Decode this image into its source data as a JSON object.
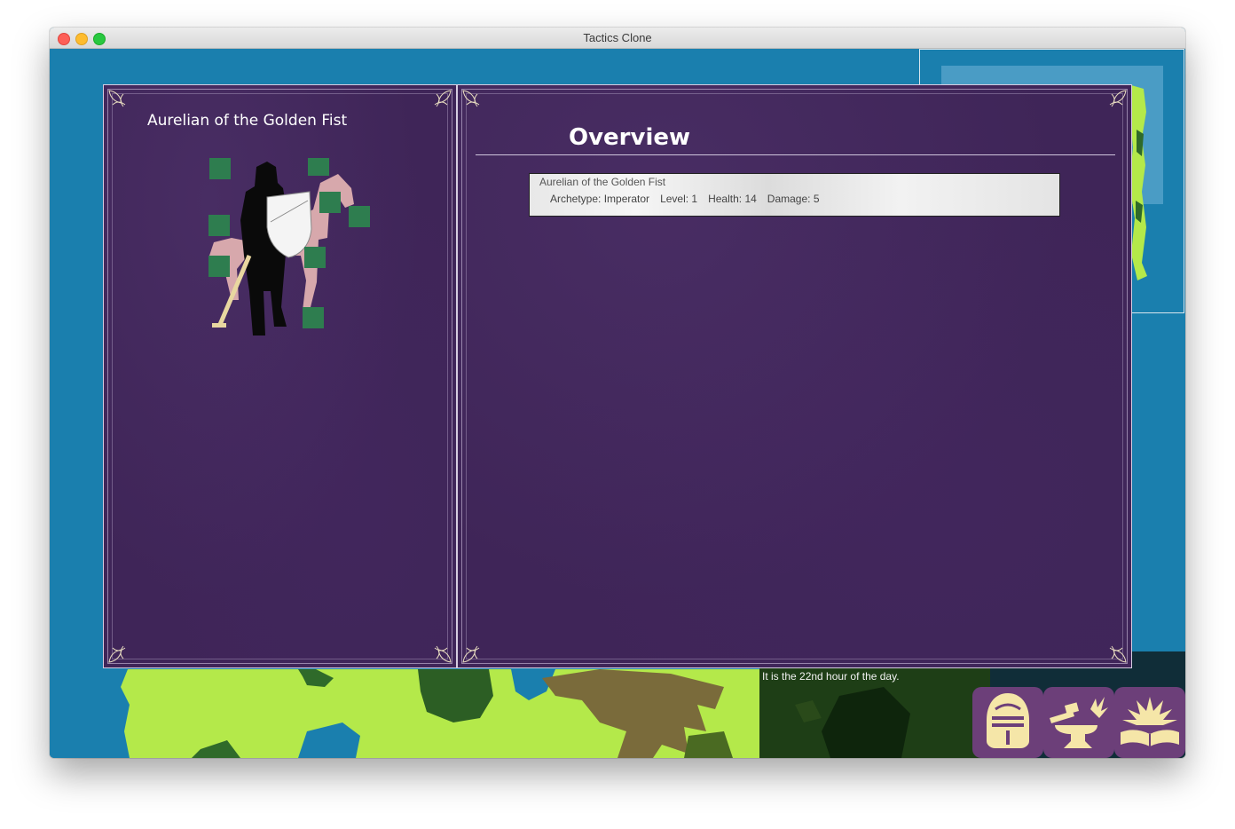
{
  "window": {
    "title": "Tactics Clone"
  },
  "status": {
    "message": "It is the 22nd hour of the day."
  },
  "character_panel": {
    "name": "Aurelian of the Golden Fist"
  },
  "overview_panel": {
    "heading": "Overview",
    "units": [
      {
        "name": "Aurelian of the Golden Fist",
        "archetype": "Archetype: Imperator",
        "level": "Level: 1",
        "health": "Health: 14",
        "damage": "Damage: 5"
      }
    ]
  },
  "actions": [
    {
      "icon": "knight-helmet-icon"
    },
    {
      "icon": "anvil-hammer-icon"
    },
    {
      "icon": "spellbook-icon"
    }
  ],
  "colors": {
    "panel_purple": "#3f2558",
    "button_purple": "#6c3f79",
    "icon_cream": "#f5e6a8",
    "water_blue": "#1a7fae",
    "grass_green": "#b4e94a",
    "equip_slot_green": "#2e7d4f"
  }
}
